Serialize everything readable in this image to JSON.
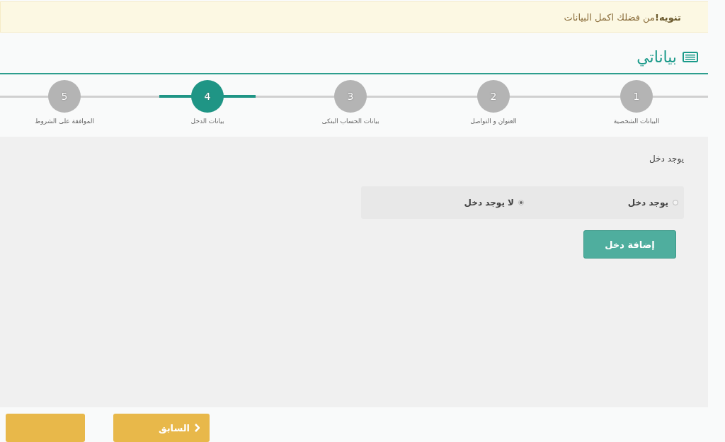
{
  "alert": {
    "title": "تنويه!",
    "message": "من فضلك اكمل البيانات"
  },
  "header": {
    "title": "بياناتي"
  },
  "steps": [
    {
      "number": "1",
      "label": "البيانات الشخصية",
      "selected": false
    },
    {
      "number": "2",
      "label": "العنوان و التواصل",
      "selected": false
    },
    {
      "number": "3",
      "label": "بيانات الحساب البنكى",
      "selected": false
    },
    {
      "number": "4",
      "label": "بيانات الدخل",
      "selected": true
    },
    {
      "number": "5",
      "label": "الموافقة على الشروط",
      "selected": false
    }
  ],
  "form": {
    "question": "يوجد دخل",
    "options": [
      {
        "label": "يوجد دخل",
        "selected": false
      },
      {
        "label": "لا يوجد دخل",
        "selected": true
      }
    ],
    "add_button": "إضافة دخل"
  },
  "footer": {
    "buttons": [
      {
        "label": "السابق",
        "kind": "previous"
      },
      {
        "kind": "blank"
      }
    ]
  }
}
